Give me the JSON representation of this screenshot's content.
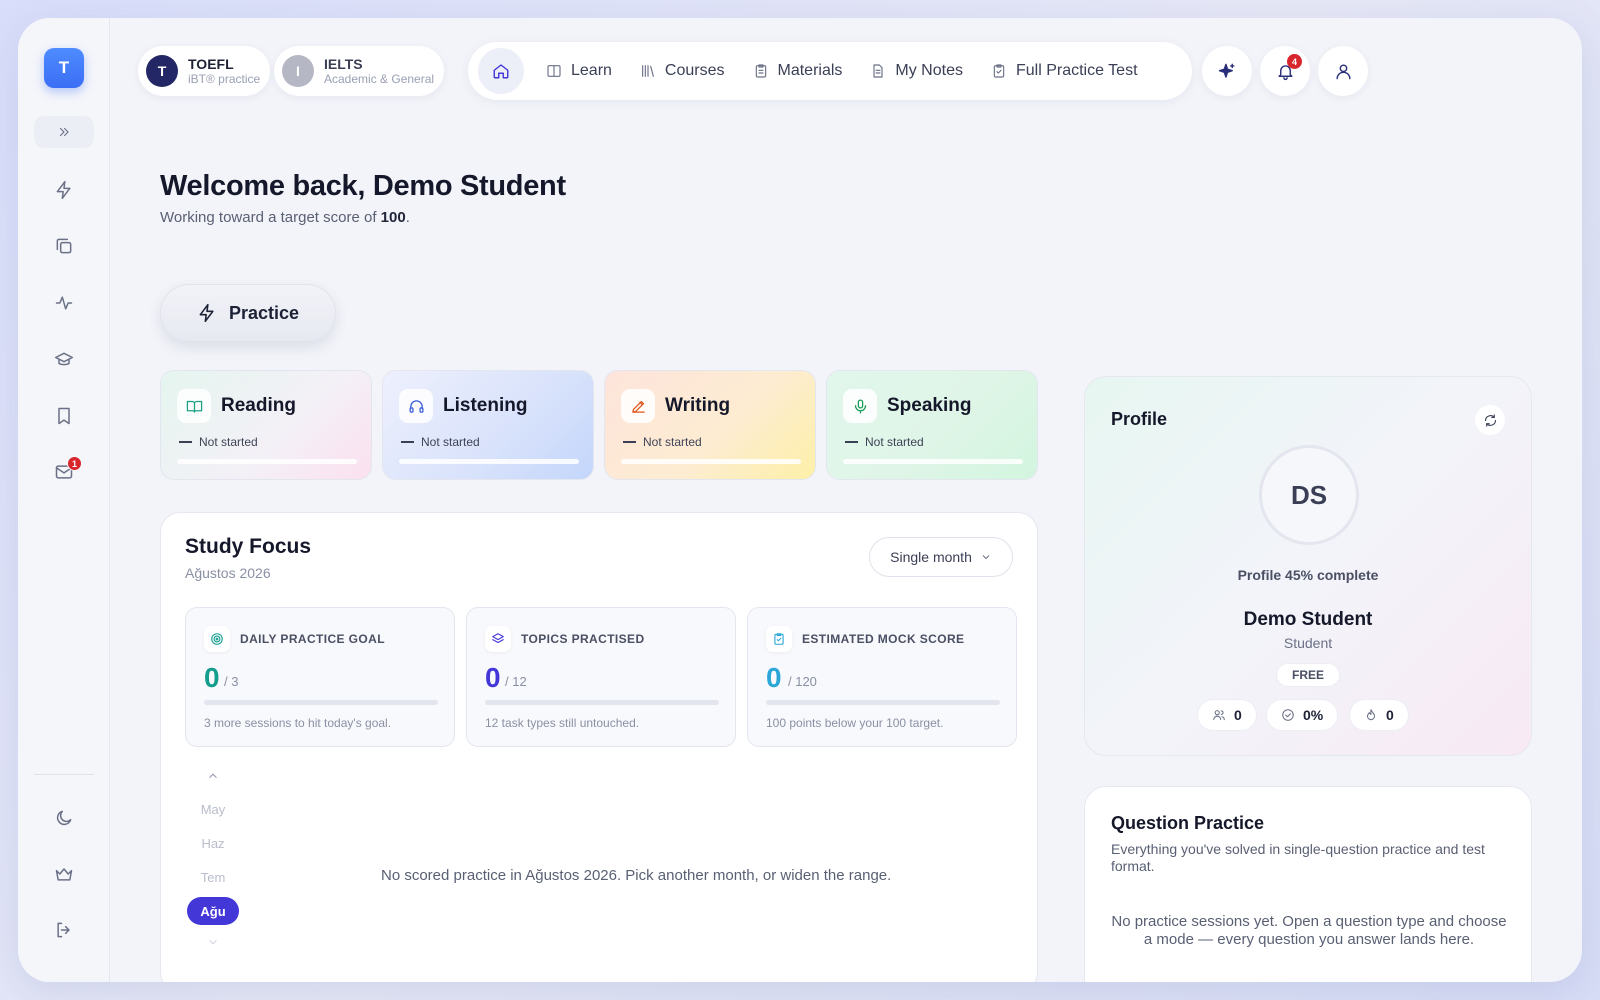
{
  "sidebar": {
    "logo": "T",
    "unread_messages": "1",
    "icons": [
      "bolt-icon",
      "copy-icon",
      "pulse-icon",
      "graduation-cap-icon",
      "bookmark-icon",
      "mail-icon",
      "moon-icon",
      "crown-icon",
      "logout-icon"
    ]
  },
  "exams": [
    {
      "initial": "T",
      "name": "TOEFL",
      "sub": "iBT® practice",
      "color": "#232766"
    },
    {
      "initial": "I",
      "name": "IELTS",
      "sub": "Academic & General",
      "color": "#b5b8c4"
    }
  ],
  "nav": {
    "items": [
      {
        "label": "Learn",
        "icon": "book-open-icon"
      },
      {
        "label": "Courses",
        "icon": "library-icon"
      },
      {
        "label": "Materials",
        "icon": "clipboard-icon"
      },
      {
        "label": "My Notes",
        "icon": "file-text-icon"
      },
      {
        "label": "Full Practice Test",
        "icon": "clipboard-check-icon"
      }
    ],
    "notifications": "4"
  },
  "welcome": {
    "title": "Welcome back, Demo Student",
    "sub_prefix": "Working toward a target score of ",
    "target": "100",
    "sub_suffix": "."
  },
  "practice": {
    "label": "Practice"
  },
  "skills": [
    {
      "name": "Reading",
      "status": "Not started",
      "progress": 0,
      "accent": "#19a184"
    },
    {
      "name": "Listening",
      "status": "Not started",
      "progress": 0,
      "accent": "#3b5bdb"
    },
    {
      "name": "Writing",
      "status": "Not started",
      "progress": 0,
      "accent": "#e0551d"
    },
    {
      "name": "Speaking",
      "status": "Not started",
      "progress": 0,
      "accent": "#1a9a55"
    }
  ],
  "study": {
    "title": "Study Focus",
    "subtitle": "Ağustos 2026",
    "range": "Single month",
    "metrics": [
      {
        "label": "DAILY PRACTICE GOAL",
        "value": "0",
        "total": "/ 3",
        "note": "3 more sessions to hit today's goal.",
        "color": "#149e8e",
        "progress": 0
      },
      {
        "label": "TOPICS PRACTISED",
        "value": "0",
        "total": "/ 12",
        "note": "12 task types still untouched.",
        "color": "#4437d8",
        "progress": 0
      },
      {
        "label": "ESTIMATED MOCK SCORE",
        "value": "0",
        "total": "/ 120",
        "note": "100 points below your 100 target.",
        "color": "#2aa7d8",
        "progress": 0
      }
    ],
    "months": [
      "May",
      "Haz",
      "Tem",
      "Ağu"
    ],
    "active_month": "Ağu",
    "empty": "No scored practice in Ağustos 2026. Pick another month, or widen the range."
  },
  "profile": {
    "title": "Profile",
    "initials": "DS",
    "complete": "Profile 45% complete",
    "name": "Demo Student",
    "role": "Student",
    "plan": "FREE",
    "stats": [
      {
        "icon": "users-icon",
        "value": "0"
      },
      {
        "icon": "check-circle-icon",
        "value": "0%"
      },
      {
        "icon": "flame-icon",
        "value": "0"
      }
    ]
  },
  "question_practice": {
    "title": "Question Practice",
    "desc": "Everything you've solved in single-question practice and test format.",
    "empty": "No practice sessions yet. Open a question type and choose a mode — every question you answer lands here."
  }
}
